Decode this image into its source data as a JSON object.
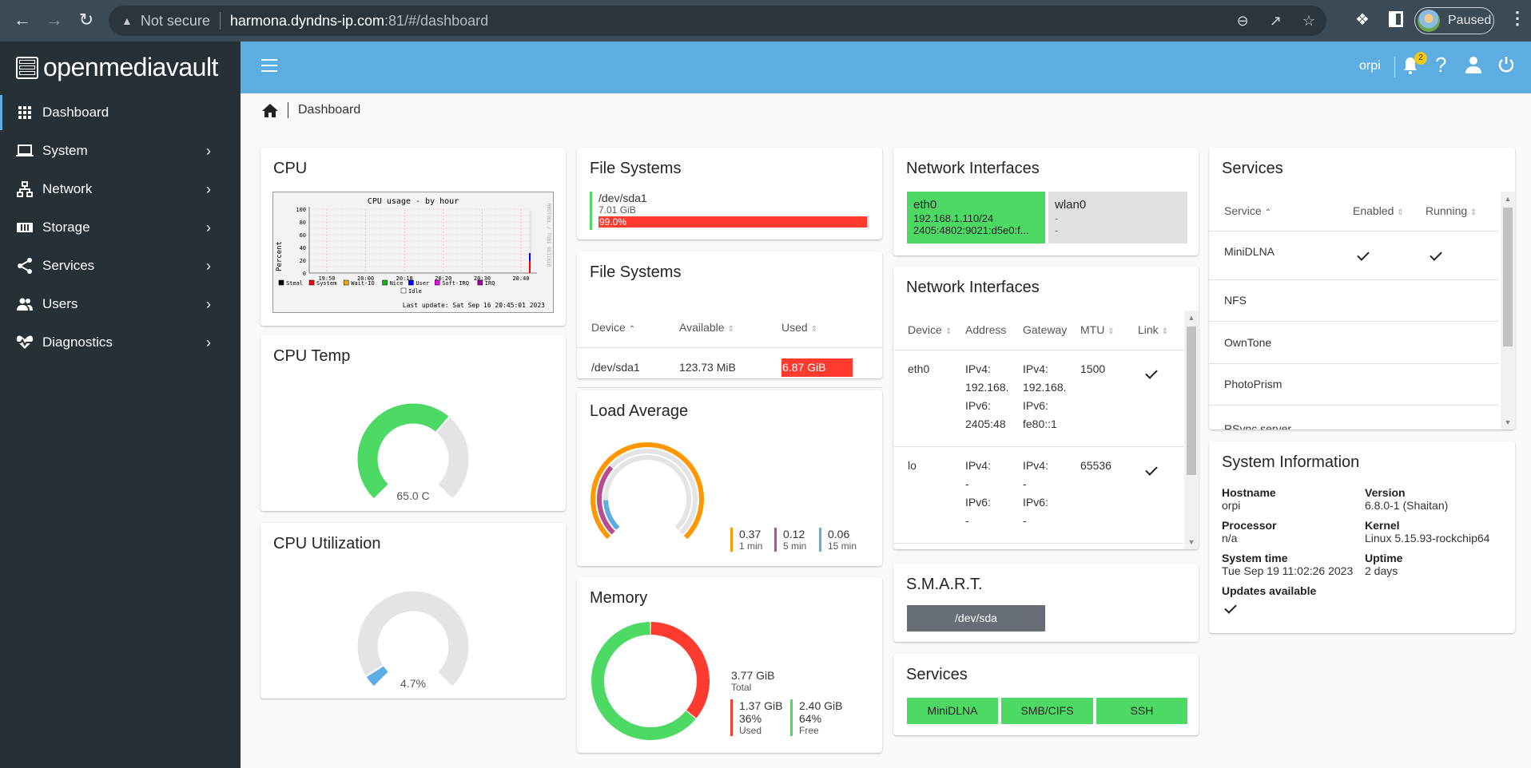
{
  "browser": {
    "security_label": "Not secure",
    "url_host": "harmona.dyndns-ip.com",
    "url_rest": ":81/#/dashboard",
    "profile_label": "Paused"
  },
  "app": {
    "name": "openmediavault",
    "header": {
      "user": "orpi",
      "notification_count": "2"
    },
    "breadcrumb": "Dashboard"
  },
  "sidebar": {
    "items": [
      {
        "label": "Dashboard",
        "icon": "grid-icon",
        "active": true
      },
      {
        "label": "System",
        "icon": "laptop-icon"
      },
      {
        "label": "Network",
        "icon": "network-icon"
      },
      {
        "label": "Storage",
        "icon": "storage-icon"
      },
      {
        "label": "Services",
        "icon": "share-icon"
      },
      {
        "label": "Users",
        "icon": "users-icon"
      },
      {
        "label": "Diagnostics",
        "icon": "heartbeat-icon"
      }
    ]
  },
  "cpu": {
    "title": "CPU",
    "graph": {
      "title": "CPU usage - by hour",
      "ylabel": "Percent",
      "yticks": [
        "100",
        "80",
        "60",
        "40",
        "20",
        "0"
      ],
      "xticks": [
        "19:50",
        "20:00",
        "20:10",
        "20:20",
        "20:30",
        "20:40"
      ],
      "legend": [
        "Steal",
        "System",
        "Wait-IO",
        "Nice",
        "User",
        "Soft-IRQ",
        "IRQ",
        "Idle"
      ],
      "legend_colors": [
        "#000000",
        "#ff0000",
        "#ffa500",
        "#00c000",
        "#0000ff",
        "#ff00ff",
        "#a000a0",
        "#ffffff"
      ],
      "last_update": "Last update: Sat Sep 16 20:45:01 2023",
      "watermark": "RRDTOOL / TOBI OETIKER"
    }
  },
  "cpu_temp": {
    "title": "CPU Temp",
    "value_label": "65.0 C",
    "fraction": 0.65,
    "color": "#4cd964"
  },
  "cpu_util": {
    "title": "CPU Utilization",
    "value_label": "4.7%",
    "fraction": 0.047,
    "color": "#5dade2"
  },
  "fs_summary": {
    "title": "File Systems",
    "device": "/dev/sda1",
    "size": "7.01 GiB",
    "percent_label": "99.0%",
    "percent": 99.0
  },
  "fs_table": {
    "title": "File Systems",
    "columns": [
      "Device",
      "Available",
      "Used"
    ],
    "rows": [
      {
        "device": "/dev/sda1",
        "available": "123.73 MiB",
        "used": "6.87 GiB"
      }
    ]
  },
  "load": {
    "title": "Load Average",
    "items": [
      {
        "value": "0.37",
        "label": "1 min",
        "color": "#ff9800",
        "fraction": 1.0
      },
      {
        "value": "0.12",
        "label": "5 min",
        "color": "#b94c8f",
        "fraction": 0.32
      },
      {
        "value": "0.06",
        "label": "15 min",
        "color": "#5dade2",
        "fraction": 0.16
      }
    ]
  },
  "memory": {
    "title": "Memory",
    "total": "3.77 GiB",
    "total_label": "Total",
    "used": {
      "value": "1.37 GiB",
      "percent": "36%",
      "label": "Used",
      "fraction": 0.36,
      "color": "#ff3b30"
    },
    "free": {
      "value": "2.40 GiB",
      "percent": "64%",
      "label": "Free",
      "fraction": 0.64,
      "color": "#4cd964"
    }
  },
  "net_summary": {
    "title": "Network Interfaces",
    "items": [
      {
        "name": "eth0",
        "ipv4": "192.168.1.110/24",
        "ipv6": "2405:4802:9021:d5e0:f...",
        "up": true
      },
      {
        "name": "wlan0",
        "ipv4": "-",
        "ipv6": "-",
        "up": false
      }
    ]
  },
  "net_table": {
    "title": "Network Interfaces",
    "columns": [
      "Device",
      "Address",
      "Gateway",
      "MTU",
      "Link"
    ],
    "rows": [
      {
        "device": "eth0",
        "address": [
          "IPv4:",
          "192.168.",
          "IPv6:",
          "2405:48"
        ],
        "gateway": [
          "IPv4:",
          "192.168.",
          "IPv6:",
          "fe80::1"
        ],
        "mtu": "1500",
        "link": true
      },
      {
        "device": "lo",
        "address": [
          "IPv4:",
          "-",
          "IPv6:",
          "-"
        ],
        "gateway": [
          "IPv4:",
          "-",
          "IPv6:",
          "-"
        ],
        "mtu": "65536",
        "link": true
      }
    ]
  },
  "smart": {
    "title": "S.M.A.R.T.",
    "devices": [
      "/dev/sda"
    ]
  },
  "services_small": {
    "title": "Services",
    "items": [
      "MiniDLNA",
      "SMB/CIFS",
      "SSH"
    ]
  },
  "services_table": {
    "title": "Services",
    "columns": [
      "Service",
      "Enabled",
      "Running"
    ],
    "rows": [
      {
        "name": "MiniDLNA",
        "enabled": true,
        "running": true
      },
      {
        "name": "NFS",
        "enabled": false,
        "running": false
      },
      {
        "name": "OwnTone",
        "enabled": false,
        "running": false
      },
      {
        "name": "PhotoPrism",
        "enabled": false,
        "running": false
      },
      {
        "name": "RSync server",
        "enabled": false,
        "running": false
      }
    ]
  },
  "sysinfo": {
    "title": "System Information",
    "hostname_label": "Hostname",
    "hostname": "orpi",
    "version_label": "Version",
    "version": "6.8.0-1 (Shaitan)",
    "processor_label": "Processor",
    "processor": "n/a",
    "kernel_label": "Kernel",
    "kernel": "Linux 5.15.93-rockchip64",
    "time_label": "System time",
    "time": "Tue Sep 19 11:02:26 2023",
    "uptime_label": "Uptime",
    "uptime": "2 days",
    "updates_label": "Updates available",
    "updates": true
  }
}
